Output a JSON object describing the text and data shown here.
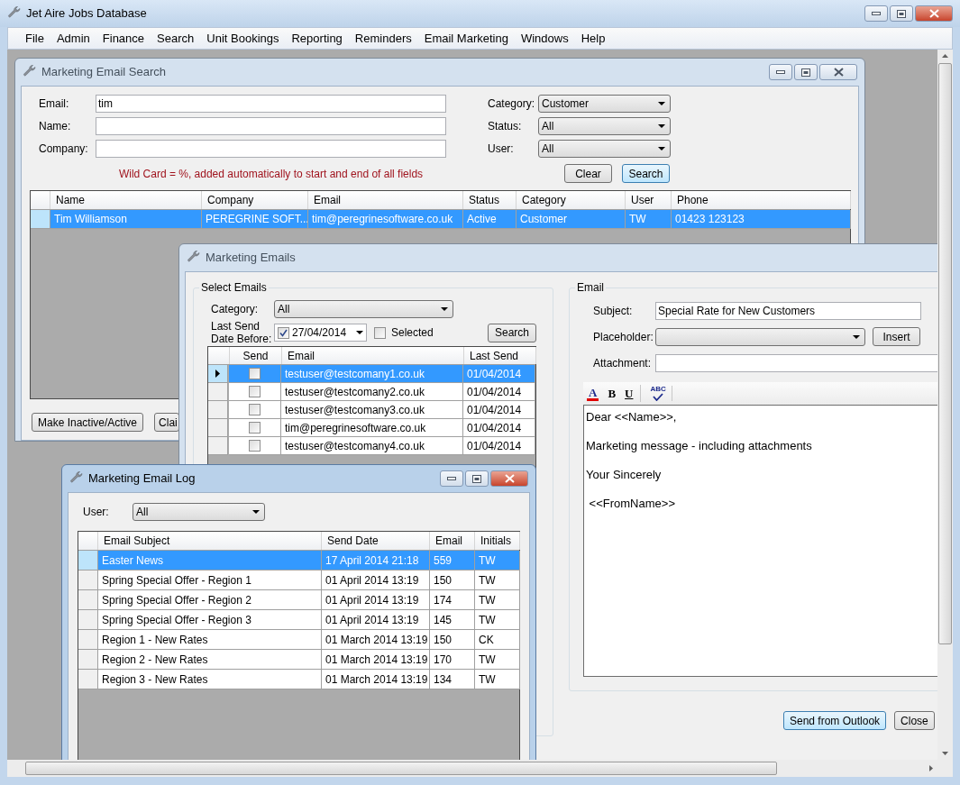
{
  "app": {
    "title": "Jet Aire Jobs Database"
  },
  "menu": [
    "File",
    "Admin",
    "Finance",
    "Search",
    "Unit Bookings",
    "Reporting",
    "Reminders",
    "Email Marketing",
    "Windows",
    "Help"
  ],
  "search_window": {
    "title": "Marketing Email Search",
    "active": false,
    "fields": [
      {
        "label": "Email:",
        "value": "tim"
      },
      {
        "label": "Name:"
      },
      {
        "label": "Company:"
      }
    ],
    "filters": [
      {
        "label": "Category:",
        "value": "Customer"
      },
      {
        "label": "Status:",
        "value": "All"
      },
      {
        "label": "User:",
        "value": "All"
      }
    ],
    "hint": "Wild Card = %, added automatically to start and end of all fields",
    "buttons": [
      {
        "label": "Clear",
        "default": false
      },
      {
        "label": "Search",
        "default": true
      }
    ],
    "table": {
      "columns": [
        "Name",
        "Company",
        "Email",
        "Status",
        "Category",
        "User",
        "Phone"
      ],
      "rows": [
        {
          "selected": true,
          "cells": [
            "Tim Williamson",
            "PEREGRINE SOFT...",
            "tim@peregrinesoftware.co.uk",
            "Active",
            "Customer",
            "TW",
            "01423 123123"
          ]
        }
      ]
    },
    "actions": [
      {
        "label": "Make Inactive/Active",
        "kind": "full"
      },
      {
        "label": "Clai",
        "kind": "covered"
      }
    ]
  },
  "emails_window": {
    "title": "Marketing Emails",
    "active": false,
    "select_group": {
      "title": "Select Emails",
      "category_label": "Category:",
      "category": "All",
      "date_label": [
        "Last Send",
        "Date Before:"
      ],
      "date_checked": true,
      "date": "27/04/2014",
      "selected_filter": {
        "label": "Selected",
        "checked": false
      },
      "search_button": "Search",
      "table": {
        "send_column": "Send",
        "columns": [
          "Email",
          "Last Send"
        ],
        "rows": [
          {
            "selected": true,
            "send": false,
            "cells": [
              "testuser@testcomany1.co.uk",
              "01/04/2014"
            ]
          },
          {
            "selected": false,
            "send": false,
            "cells": [
              "testuser@testcomany2.co.uk",
              "01/04/2014"
            ]
          },
          {
            "selected": false,
            "send": false,
            "cells": [
              "testuser@testcomany3.co.uk",
              "01/04/2014"
            ]
          },
          {
            "selected": false,
            "send": false,
            "cells": [
              "tim@peregrinesoftware.co.uk",
              "01/04/2014"
            ]
          },
          {
            "selected": false,
            "send": false,
            "cells": [
              "testuser@testcomany4.co.uk",
              "01/04/2014"
            ]
          }
        ]
      }
    },
    "email_group": {
      "title": "Email",
      "subject_label": "Subject:",
      "subject": "Special Rate for New Customers",
      "placeholder_label": "Placeholder:",
      "insert_button": "Insert",
      "attachment_label": "Attachment:",
      "toolbar": [
        {
          "kind": "color",
          "glyph": "A"
        },
        {
          "kind": "bold",
          "glyph": "B"
        },
        {
          "kind": "underline",
          "glyph": "U"
        },
        {
          "kind": "spell",
          "glyph": "ABC"
        }
      ],
      "body": [
        "Dear <<Name>>,",
        "Marketing message - including attachments",
        "Your Sincerely",
        " <<FromName>>"
      ]
    },
    "buttons": [
      {
        "label": "Send from Outlook",
        "default": true
      },
      {
        "label": "Close",
        "default": false
      }
    ]
  },
  "log_window": {
    "title": "Marketing Email Log",
    "active": true,
    "user_label": "User:",
    "user": "All",
    "table": {
      "columns": [
        "Email Subject",
        "Send Date",
        "Email",
        "Initials"
      ],
      "rows": [
        {
          "selected": true,
          "cells": [
            "Easter News",
            "17 April 2014 21:18",
            "559",
            "TW"
          ]
        },
        {
          "selected": false,
          "cells": [
            "Spring Special Offer - Region 1",
            "01 April 2014 13:19",
            "150",
            "TW"
          ]
        },
        {
          "selected": false,
          "cells": [
            "Spring Special Offer - Region 2",
            "01 April 2014 13:19",
            "174",
            "TW"
          ]
        },
        {
          "selected": false,
          "cells": [
            "Spring Special Offer - Region 3",
            "01 April 2014 13:19",
            "145",
            "TW"
          ]
        },
        {
          "selected": false,
          "cells": [
            "Region 1 - New Rates",
            "01 March 2014 13:19",
            "150",
            "CK"
          ]
        },
        {
          "selected": false,
          "cells": [
            "Region 2 - New Rates",
            "01 March 2014 13:19",
            "170",
            "TW"
          ]
        },
        {
          "selected": false,
          "cells": [
            "Region 3 - New Rates",
            "01 March 2014 13:19",
            "134",
            "TW"
          ]
        }
      ]
    }
  }
}
